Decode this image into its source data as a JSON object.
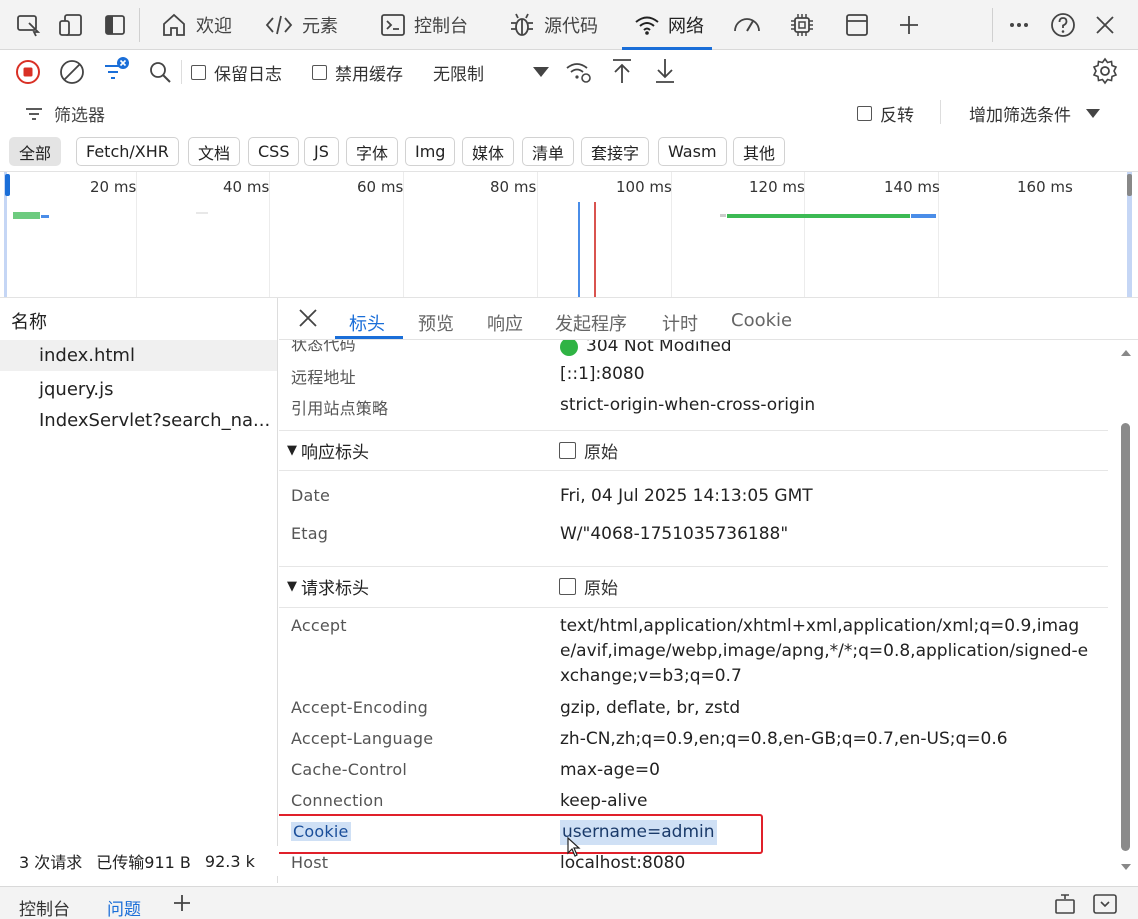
{
  "tabbar": {
    "tabs": [
      {
        "label": "欢迎",
        "icon": "home-icon"
      },
      {
        "label": "元素",
        "icon": "code-tag-icon"
      },
      {
        "label": "控制台",
        "icon": "console-icon"
      },
      {
        "label": "源代码",
        "icon": "bug-icon"
      },
      {
        "label": "网络",
        "icon": "wifi-icon"
      }
    ],
    "active_tab": "网络"
  },
  "toolbar": {
    "preserve_log_label": "保留日志",
    "disable_cache_label": "禁用缓存",
    "throttle_value": "无限制"
  },
  "filter": {
    "filter_label": "筛选器",
    "invert_label": "反转",
    "more_filters_label": "增加筛选条件"
  },
  "type_filters": [
    "全部",
    "Fetch/XHR",
    "文档",
    "CSS",
    "JS",
    "字体",
    "Img",
    "媒体",
    "清单",
    "套接字",
    "Wasm",
    "其他"
  ],
  "timeline": {
    "ticks": [
      "20 ms",
      "40 ms",
      "60 ms",
      "80 ms",
      "100 ms",
      "120 ms",
      "140 ms",
      "160 ms"
    ]
  },
  "request_list": {
    "header": "名称",
    "items": [
      "index.html",
      "jquery.js",
      "IndexServlet?search_na..."
    ]
  },
  "status": {
    "requests": "3 次请求",
    "transferred": "已传输911 B",
    "size": "92.3 k"
  },
  "details": {
    "tabs": [
      "标头",
      "预览",
      "响应",
      "发起程序",
      "计时",
      "Cookie"
    ],
    "active_tab": "标头",
    "general": [
      {
        "key": "状态代码",
        "value": "304 Not Modified"
      },
      {
        "key": "远程地址",
        "value": "[::1]:8080"
      },
      {
        "key": "引用站点策略",
        "value": "strict-origin-when-cross-origin"
      }
    ],
    "response_headers": {
      "title": "响应标头",
      "raw_label": "原始",
      "rows": [
        {
          "key": "Date",
          "value": "Fri, 04 Jul 2025 14:13:05 GMT"
        },
        {
          "key": "Etag",
          "value": "W/\"4068-1751035736188\""
        }
      ]
    },
    "request_headers": {
      "title": "请求标头",
      "raw_label": "原始",
      "rows": [
        {
          "key": "Accept",
          "value": "text/html,application/xhtml+xml,application/xml;q=0.9,image/avif,image/webp,image/apng,*/*;q=0.8,application/signed-exchange;v=b3;q=0.7"
        },
        {
          "key": "Accept-Encoding",
          "value": "gzip, deflate, br, zstd"
        },
        {
          "key": "Accept-Language",
          "value": "zh-CN,zh;q=0.9,en;q=0.8,en-GB;q=0.7,en-US;q=0.6"
        },
        {
          "key": "Cache-Control",
          "value": "max-age=0"
        },
        {
          "key": "Connection",
          "value": "keep-alive"
        },
        {
          "key": "Cookie",
          "value": "username=admin"
        },
        {
          "key": "Host",
          "value": "localhost:8080"
        }
      ]
    }
  },
  "drawer": {
    "tabs": [
      "控制台",
      "问题"
    ],
    "active_tab": "问题"
  },
  "colors": {
    "accent": "#1a6ed8",
    "record": "#d93025",
    "status_ok": "#2fb344",
    "highlight_box": "#e0202a",
    "selection": "#cfe0f5"
  }
}
